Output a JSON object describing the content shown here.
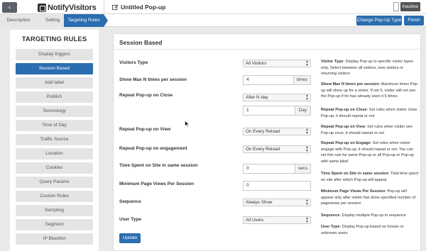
{
  "header": {
    "back_icon": "chevron-left",
    "brand": "NotifyVisitors",
    "edit_icon": "edit-square-icon",
    "title": "Untitled Pop-up",
    "status": "Inactive"
  },
  "steps": [
    {
      "label": "Description"
    },
    {
      "label": "Setting"
    },
    {
      "label": "Targeting Rules"
    }
  ],
  "actions": {
    "change_type": "Change Pop-Up Type",
    "finish": "Finish"
  },
  "sidebar": {
    "title": "TARGETING RULES",
    "items": [
      {
        "label": "Display triggers"
      },
      {
        "label": "Session Based"
      },
      {
        "label": "Add label"
      },
      {
        "label": "Publish"
      },
      {
        "label": "Technology"
      },
      {
        "label": "Time of Day"
      },
      {
        "label": "Traffic Source"
      },
      {
        "label": "Location"
      },
      {
        "label": "Cookies"
      },
      {
        "label": "Query Params"
      },
      {
        "label": "Custom Rules"
      },
      {
        "label": "Sampling"
      },
      {
        "label": "Segment"
      },
      {
        "label": "IP Blacklist"
      }
    ],
    "active_index": 1
  },
  "panel": {
    "title": "Session Based",
    "fields": {
      "visitors_type": {
        "label": "Visitors Type",
        "value": "All Visitors"
      },
      "max_times": {
        "label": "Show Max N times per session",
        "value": "4",
        "unit": "times"
      },
      "repeat_close": {
        "label": "Repeat Pop-up on Close",
        "value": "After N day",
        "days": "1",
        "unit": "Day"
      },
      "repeat_view": {
        "label": "Repeat Pop-up on View",
        "value": "On Every Reload"
      },
      "repeat_engagement": {
        "label": "Repeat Pop-up on engagement",
        "value": "On Every Reload"
      },
      "time_spent": {
        "label": "Time Spent on Site in same session",
        "value": "0",
        "unit": "secs"
      },
      "min_pageviews": {
        "label": "Minimum Page Views Per Session",
        "value": "0"
      },
      "sequence": {
        "label": "Sequence",
        "value": "Always Show"
      },
      "user_type": {
        "label": "User Type",
        "value": "All Users"
      }
    },
    "update": "Update"
  },
  "help": [
    {
      "term": "Visitor Type",
      "text": ": Display Pop-up to specific visitor types only. Select between all visitors, new visitors or returning visitors"
    },
    {
      "term": "Show Max N times per session",
      "text": ": Maximum times Pop-up will show up for a visitor. If set 5, visitor will not see the Pop-up if he has already seen it 5 times."
    },
    {
      "term": "Repeat Pop-up on Close",
      "text": ": Set rules when visitor close Pop-up, it should repeat or not"
    },
    {
      "term": "Repeat Pop-up on View",
      "text": ": Set rules when visitor see Pop-up once, it should repeat or not"
    },
    {
      "term": "Repeat Pop-up on Engage",
      "text": ": Set rules when visitor engage with Pop-up, it should repeat or not. You can set this rule for same Pop-up or all Pop-up or Pop-up with same label"
    },
    {
      "term": "Time Spent on Site in same session",
      "text": ": Total time spent on site after which Pop-up will appear"
    },
    {
      "term": "Minimum Page Views Per Session",
      "text": ": Pop-up will appear only after visitor has done specified number of pageviews per session"
    },
    {
      "term": "Sequence",
      "text": ": Display multiple Pop-up in sequence"
    },
    {
      "term": "User Type",
      "text": ": Display Pop-up based on known or unknown users"
    }
  ]
}
